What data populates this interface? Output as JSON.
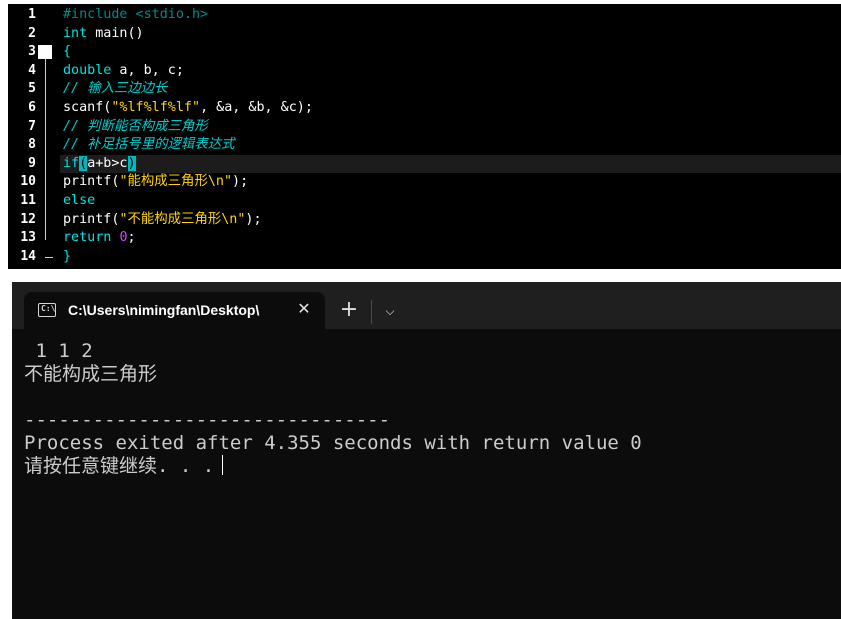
{
  "editor": {
    "line_numbers": [
      "1",
      "2",
      "3",
      "4",
      "5",
      "6",
      "7",
      "8",
      "9",
      "10",
      "11",
      "12",
      "13",
      "14"
    ],
    "lines": [
      [
        {
          "t": "pp",
          "v": "#include <stdio.h>"
        }
      ],
      [
        {
          "t": "kw",
          "v": "int"
        },
        {
          "t": "pl",
          "v": " main()"
        }
      ],
      [
        {
          "t": "kw",
          "v": "{"
        }
      ],
      [
        {
          "t": "kw",
          "v": "double"
        },
        {
          "t": "pl",
          "v": " a, b, c;"
        }
      ],
      [
        {
          "t": "cm",
          "v": "// 输入三边边长"
        }
      ],
      [
        {
          "t": "pl",
          "v": "scanf("
        },
        {
          "t": "st",
          "v": "\"%lf%lf%lf\""
        },
        {
          "t": "pl",
          "v": ", &a, &b, &c);"
        }
      ],
      [
        {
          "t": "cm",
          "v": "// 判断能否构成三角形"
        }
      ],
      [
        {
          "t": "cm",
          "v": "// 补足括号里的逻辑表达式"
        }
      ],
      [
        {
          "t": "kw",
          "v": "if"
        },
        {
          "t": "br",
          "v": "("
        },
        {
          "t": "pl",
          "v": "a+b>c"
        },
        {
          "t": "br",
          "v": ")"
        }
      ],
      [
        {
          "t": "pl",
          "v": "printf("
        },
        {
          "t": "st",
          "v": "\"能构成三角形\\n\""
        },
        {
          "t": "pl",
          "v": ");"
        }
      ],
      [
        {
          "t": "kw",
          "v": "else"
        }
      ],
      [
        {
          "t": "pl",
          "v": "printf("
        },
        {
          "t": "st",
          "v": "\"不能构成三角形\\n\""
        },
        {
          "t": "pl",
          "v": ");"
        }
      ],
      [
        {
          "t": "kw",
          "v": "return"
        },
        {
          "t": "pl",
          "v": " "
        },
        {
          "t": "nm",
          "v": "0"
        },
        {
          "t": "pl",
          "v": ";"
        }
      ],
      [
        {
          "t": "kw",
          "v": "}"
        }
      ]
    ],
    "current_line": 9
  },
  "terminal": {
    "tab_title": "C:\\Users\\nimingfan\\Desktop\\",
    "tab_icon_text": "C:\\",
    "close_glyph": "✕",
    "add_glyph": "+",
    "dropdown_glyph": "⌵",
    "output": [
      " 1 1 2",
      "不能构成三角形",
      "",
      "--------------------------------",
      "Process exited after 4.355 seconds with return value 0",
      "请按任意键继续. . ."
    ]
  },
  "colors": {
    "keyword": "#00e0e0",
    "comment": "#00cccc",
    "string": "#ffd400",
    "number": "#e040ff",
    "bracket_highlight": "#00b8c0",
    "terminal_bg": "#0c0c0c"
  }
}
